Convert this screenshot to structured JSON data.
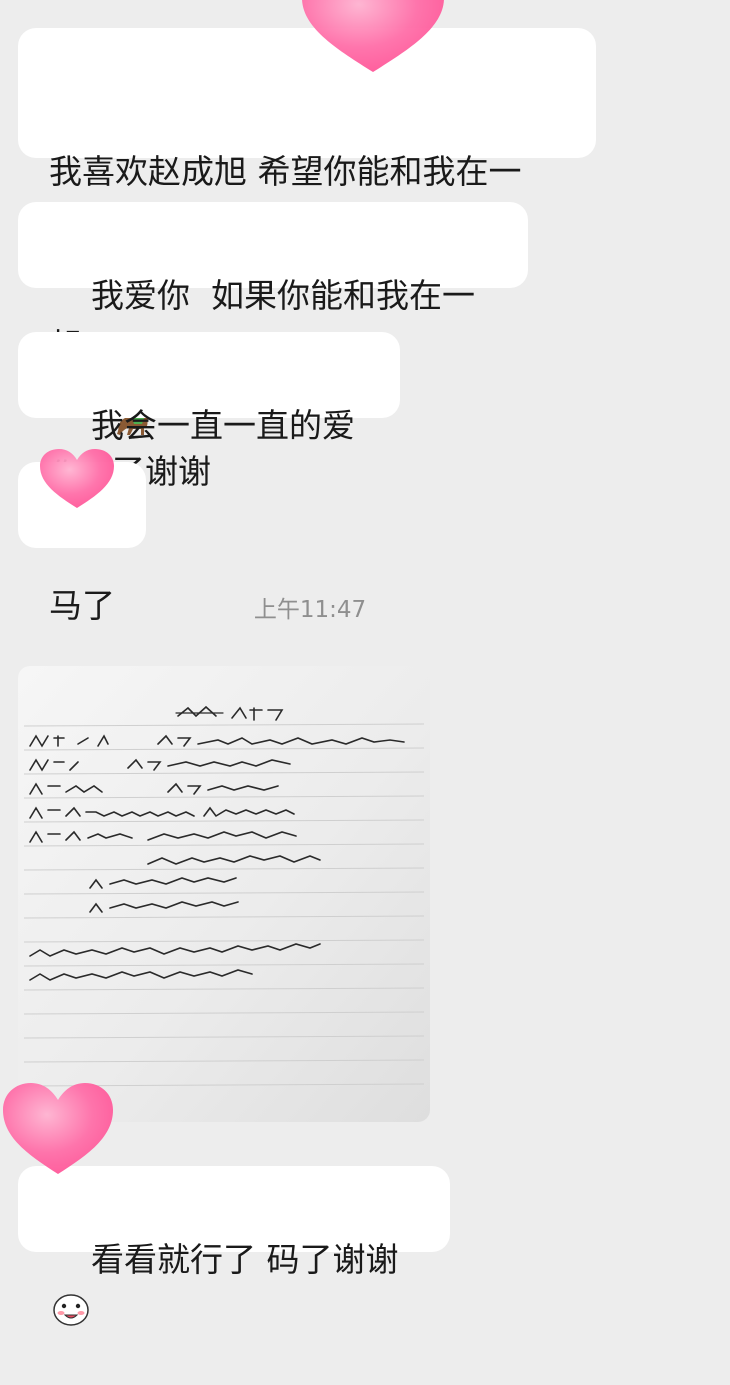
{
  "messages": [
    {
      "line1": "我喜欢赵成旭 希望你能和我在一",
      "line2_start": "起",
      "emoji": "horse-emoji",
      "line2_end": "了谢谢"
    },
    {
      "text": "我爱你  如果你能和我在一起"
    },
    {
      "text": "我会一直一直的爱你"
    },
    {
      "text": "马了"
    },
    {
      "text": "看看就行了 码了谢谢",
      "emoji": "smiling-face-emoji"
    }
  ],
  "timestamp": "上午11:47",
  "photo": {
    "description_icon": "handwritten-note-photo"
  },
  "colors": {
    "background": "#ededed",
    "bubble": "#ffffff",
    "text": "#1a1a1a",
    "timestamp": "#8f8f8f",
    "heart_sticker": "#ff6ea8"
  }
}
